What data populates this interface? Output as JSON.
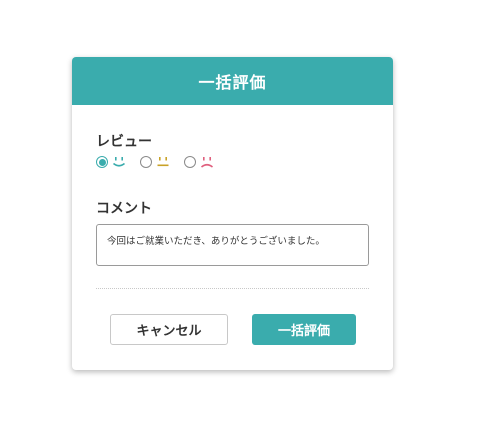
{
  "dialog": {
    "title": "一括評価",
    "review_label": "レビュー",
    "rating_options": [
      {
        "icon": "smile-face-icon",
        "color": "#3aacad",
        "selected": true
      },
      {
        "icon": "neutral-face-icon",
        "color": "#c9a227",
        "selected": false
      },
      {
        "icon": "sad-face-icon",
        "color": "#e0607e",
        "selected": false
      }
    ],
    "comment_label": "コメント",
    "comment_value": "今回はご就業いただき、ありがとうございました。",
    "cancel_label": "キャンセル",
    "submit_label": "一括評価"
  },
  "colors": {
    "accent": "#3aacad"
  }
}
